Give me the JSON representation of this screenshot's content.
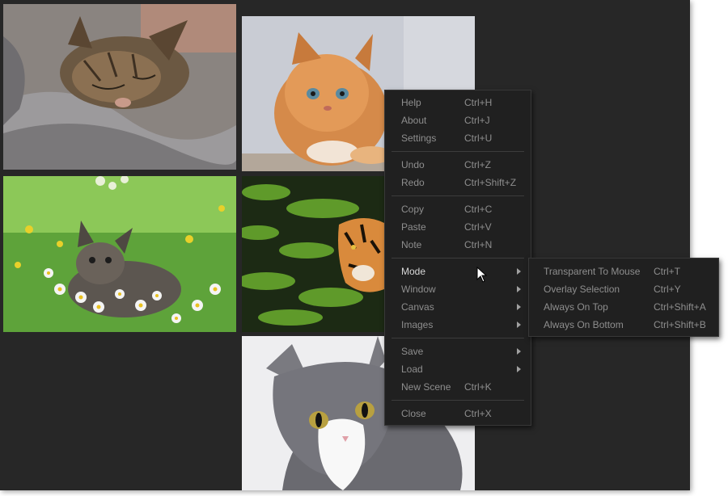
{
  "menu": {
    "items": [
      {
        "label": "Help",
        "shortcut": "Ctrl+H"
      },
      {
        "label": "About",
        "shortcut": "Ctrl+J"
      },
      {
        "label": "Settings",
        "shortcut": "Ctrl+U"
      },
      {
        "label": "Undo",
        "shortcut": "Ctrl+Z"
      },
      {
        "label": "Redo",
        "shortcut": "Ctrl+Shift+Z"
      },
      {
        "label": "Copy",
        "shortcut": "Ctrl+C"
      },
      {
        "label": "Paste",
        "shortcut": "Ctrl+V"
      },
      {
        "label": "Note",
        "shortcut": "Ctrl+N"
      },
      {
        "label": "Mode",
        "shortcut": ""
      },
      {
        "label": "Window",
        "shortcut": ""
      },
      {
        "label": "Canvas",
        "shortcut": ""
      },
      {
        "label": "Images",
        "shortcut": ""
      },
      {
        "label": "Save",
        "shortcut": ""
      },
      {
        "label": "Load",
        "shortcut": ""
      },
      {
        "label": "New Scene",
        "shortcut": "Ctrl+K"
      },
      {
        "label": "Close",
        "shortcut": "Ctrl+X"
      }
    ]
  },
  "submenu": {
    "items": [
      {
        "label": "Transparent To Mouse",
        "shortcut": "Ctrl+T"
      },
      {
        "label": "Overlay Selection",
        "shortcut": "Ctrl+Y"
      },
      {
        "label": "Always On Top",
        "shortcut": "Ctrl+Shift+A"
      },
      {
        "label": "Always On Bottom",
        "shortcut": "Ctrl+Shift+B"
      }
    ]
  },
  "colors": {
    "canvas_bg": "#272727",
    "menu_bg": "#202020",
    "menu_text": "#8e8e8e",
    "menu_text_highlight": "#d8d8d8"
  },
  "icons": {
    "submenu_arrow": "chevron-right-icon",
    "cursor": "mouse-pointer-icon"
  }
}
